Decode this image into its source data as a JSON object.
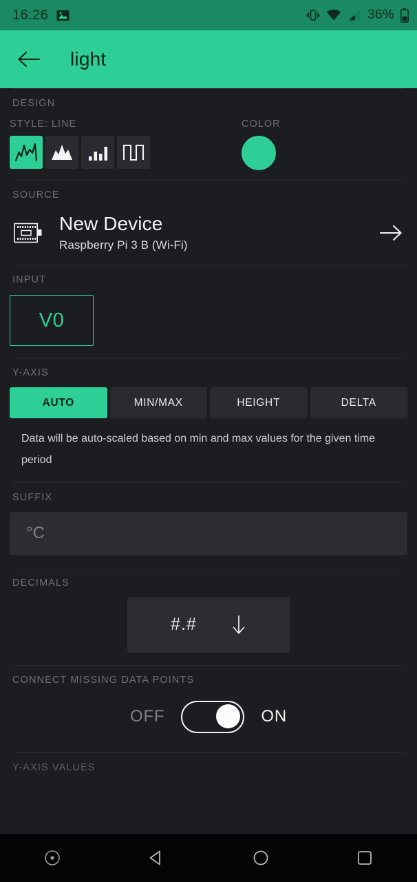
{
  "status_bar": {
    "time": "16:26",
    "battery_percent": "36%",
    "icons": [
      "image-notification-icon",
      "vibrate-icon",
      "wifi-icon",
      "cellular-signal-icon",
      "battery-icon"
    ],
    "background_color": "#1a8a63"
  },
  "app_bar": {
    "back_label": "back-arrow",
    "title": "light",
    "background_color": "#2ecf96"
  },
  "design": {
    "section_label": "DESIGN",
    "style_label": "STYLE: LINE",
    "color_label": "COLOR",
    "selected_style_index": 0,
    "styles": [
      {
        "name": "line-chart-style",
        "selected": true
      },
      {
        "name": "area-chart-style",
        "selected": false
      },
      {
        "name": "bar-chart-style",
        "selected": false
      },
      {
        "name": "step-chart-style",
        "selected": false
      }
    ],
    "color_value": "#2ecf96"
  },
  "source": {
    "section_label": "SOURCE",
    "device_name": "New Device",
    "device_subtitle": "Raspberry Pi 3 B (Wi-Fi)",
    "icon": "board-chip-icon",
    "chevron": "arrow-right-icon"
  },
  "input": {
    "section_label": "INPUT",
    "pin_value": "V0",
    "accent_color": "#2ecf96"
  },
  "y_axis": {
    "section_label": "Y-AXIS",
    "tabs": [
      {
        "label": "AUTO",
        "selected": true
      },
      {
        "label": "MIN/MAX",
        "selected": false
      },
      {
        "label": "HEIGHT",
        "selected": false
      },
      {
        "label": "DELTA",
        "selected": false
      }
    ],
    "help_text": "Data will be auto-scaled based on min and max values for the given time period"
  },
  "suffix": {
    "section_label": "SUFFIX",
    "value": "",
    "placeholder": "°C"
  },
  "decimals": {
    "section_label": "DECIMALS",
    "value": "#.#",
    "dropdown_icon": "arrow-down-icon"
  },
  "connect_missing": {
    "section_label": "CONNECT MISSING DATA POINTS",
    "off_label": "OFF",
    "on_label": "ON",
    "state": "ON"
  },
  "next_section": {
    "section_label": "Y-AXIS VALUES"
  },
  "nav_bar": {
    "items": [
      {
        "name": "assistant-dot-icon"
      },
      {
        "name": "back-triangle-icon"
      },
      {
        "name": "home-circle-icon"
      },
      {
        "name": "recents-square-icon"
      }
    ]
  }
}
